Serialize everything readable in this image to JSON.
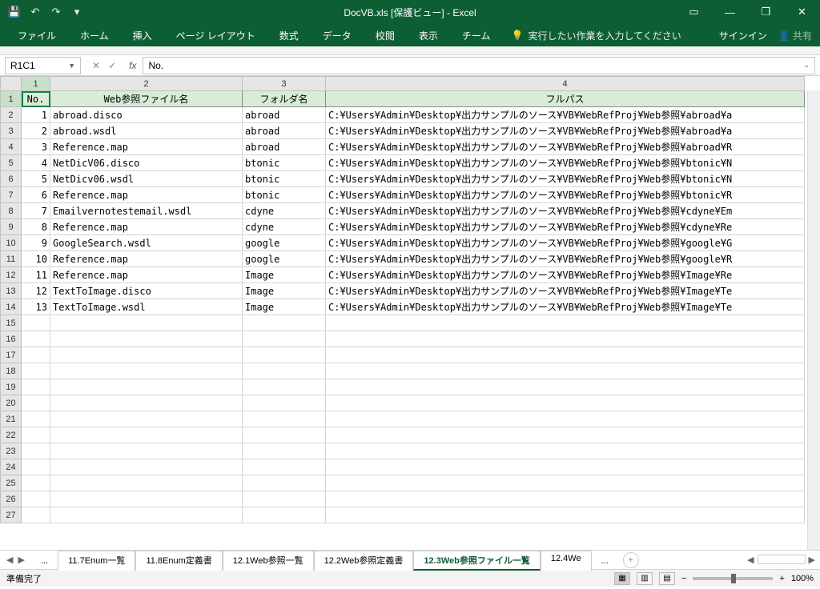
{
  "title": "DocVB.xls  [保護ビュー] - Excel",
  "qat_icons": [
    "save-icon",
    "undo-icon",
    "redo-icon",
    "customize-icon"
  ],
  "window_controls": [
    "ribbon-options-icon",
    "minimize-icon",
    "restore-icon",
    "close-icon"
  ],
  "ribbon": {
    "tabs": [
      "ファイル",
      "ホーム",
      "挿入",
      "ページ レイアウト",
      "数式",
      "データ",
      "校閲",
      "表示",
      "チーム"
    ],
    "tell_me": "実行したい作業を入力してください",
    "sign_in": "サインイン",
    "share": "共有"
  },
  "namebox": "R1C1",
  "formula": "No.",
  "col_headers": [
    "1",
    "2",
    "3",
    "4"
  ],
  "row_headers": [
    "1",
    "2",
    "3",
    "4",
    "5",
    "6",
    "7",
    "8",
    "9",
    "10",
    "11",
    "12",
    "13",
    "14",
    "15",
    "16",
    "17",
    "18",
    "19",
    "20",
    "21",
    "22",
    "23",
    "24",
    "25",
    "26",
    "27"
  ],
  "table_headers": [
    "No.",
    "Web参照ファイル名",
    "フォルダ名",
    "フルパス"
  ],
  "rows": [
    {
      "no": "1",
      "file": "abroad.disco",
      "folder": "abroad",
      "path": "C:¥Users¥Admin¥Desktop¥出力サンプルのソース¥VB¥WebRefProj¥Web参照¥abroad¥a"
    },
    {
      "no": "2",
      "file": "abroad.wsdl",
      "folder": "abroad",
      "path": "C:¥Users¥Admin¥Desktop¥出力サンプルのソース¥VB¥WebRefProj¥Web参照¥abroad¥a"
    },
    {
      "no": "3",
      "file": "Reference.map",
      "folder": "abroad",
      "path": "C:¥Users¥Admin¥Desktop¥出力サンプルのソース¥VB¥WebRefProj¥Web参照¥abroad¥R"
    },
    {
      "no": "4",
      "file": "NetDicV06.disco",
      "folder": "btonic",
      "path": "C:¥Users¥Admin¥Desktop¥出力サンプルのソース¥VB¥WebRefProj¥Web参照¥btonic¥N"
    },
    {
      "no": "5",
      "file": "NetDicv06.wsdl",
      "folder": "btonic",
      "path": "C:¥Users¥Admin¥Desktop¥出力サンプルのソース¥VB¥WebRefProj¥Web参照¥btonic¥N"
    },
    {
      "no": "6",
      "file": "Reference.map",
      "folder": "btonic",
      "path": "C:¥Users¥Admin¥Desktop¥出力サンプルのソース¥VB¥WebRefProj¥Web参照¥btonic¥R"
    },
    {
      "no": "7",
      "file": "Emailvernotestemail.wsdl",
      "folder": "cdyne",
      "path": "C:¥Users¥Admin¥Desktop¥出力サンプルのソース¥VB¥WebRefProj¥Web参照¥cdyne¥Em"
    },
    {
      "no": "8",
      "file": "Reference.map",
      "folder": "cdyne",
      "path": "C:¥Users¥Admin¥Desktop¥出力サンプルのソース¥VB¥WebRefProj¥Web参照¥cdyne¥Re"
    },
    {
      "no": "9",
      "file": "GoogleSearch.wsdl",
      "folder": "google",
      "path": "C:¥Users¥Admin¥Desktop¥出力サンプルのソース¥VB¥WebRefProj¥Web参照¥google¥G"
    },
    {
      "no": "10",
      "file": "Reference.map",
      "folder": "google",
      "path": "C:¥Users¥Admin¥Desktop¥出力サンプルのソース¥VB¥WebRefProj¥Web参照¥google¥R"
    },
    {
      "no": "11",
      "file": "Reference.map",
      "folder": "Image",
      "path": "C:¥Users¥Admin¥Desktop¥出力サンプルのソース¥VB¥WebRefProj¥Web参照¥Image¥Re"
    },
    {
      "no": "12",
      "file": "TextToImage.disco",
      "folder": "Image",
      "path": "C:¥Users¥Admin¥Desktop¥出力サンプルのソース¥VB¥WebRefProj¥Web参照¥Image¥Te"
    },
    {
      "no": "13",
      "file": "TextToImage.wsdl",
      "folder": "Image",
      "path": "C:¥Users¥Admin¥Desktop¥出力サンプルのソース¥VB¥WebRefProj¥Web参照¥Image¥Te"
    }
  ],
  "sheet_tabs": {
    "items": [
      "11.7Enum一覧",
      "11.8Enum定義書",
      "12.1Web参照一覧",
      "12.2Web参照定義書",
      "12.3Web参照ファイル一覧",
      "12.4We"
    ],
    "active_index": 4,
    "ellipsis_left": "...",
    "ellipsis_right": "..."
  },
  "status": {
    "ready": "準備完了",
    "zoom": "100%"
  }
}
